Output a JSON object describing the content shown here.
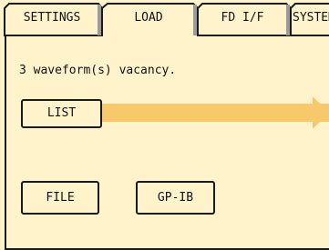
{
  "tabs": [
    {
      "id": "settings",
      "label": "SETTINGS",
      "active": false
    },
    {
      "id": "load",
      "label": "LOAD",
      "active": true
    },
    {
      "id": "fd_if",
      "label": "FD I/F",
      "active": false
    },
    {
      "id": "system",
      "label": "SYSTEM",
      "active": false
    }
  ],
  "load_panel": {
    "status_text": "3 waveform(s) vacancy.",
    "list_button": "LIST",
    "file_button": "FILE",
    "gpib_button": "GP-IB"
  },
  "colors": {
    "background": "#fff3cc",
    "highlight": "#f7c96a",
    "outline": "#1a1a1a"
  }
}
